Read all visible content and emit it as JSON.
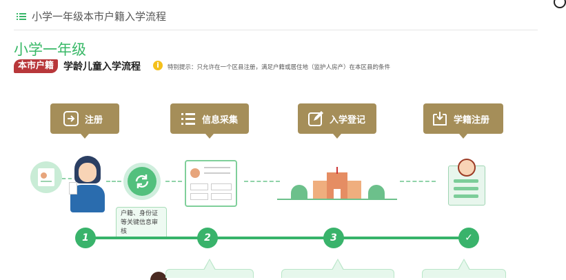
{
  "header": {
    "title": "小学一年级本市户籍入学流程"
  },
  "section": {
    "grade": "小学一年级",
    "badge": "本市户籍",
    "subtitle": "学龄儿童入学流程",
    "tip": "特别提示：只允许在一个区县注册，满足户籍或居住地（监护人房产）在本区县的条件"
  },
  "steps": [
    {
      "label": "注册",
      "icon": "login-icon"
    },
    {
      "label": "信息采集",
      "icon": "list-icon"
    },
    {
      "label": "入学登记",
      "icon": "edit-icon"
    },
    {
      "label": "学籍注册",
      "icon": "inbox-icon"
    }
  ],
  "timeline": {
    "nodes": [
      "1",
      "2",
      "3",
      "✓"
    ],
    "note": "户籍、身份证等关键信息审核"
  },
  "colors": {
    "accent": "#37b866",
    "bubble": "#a58e59",
    "badge": "#b8373a"
  }
}
